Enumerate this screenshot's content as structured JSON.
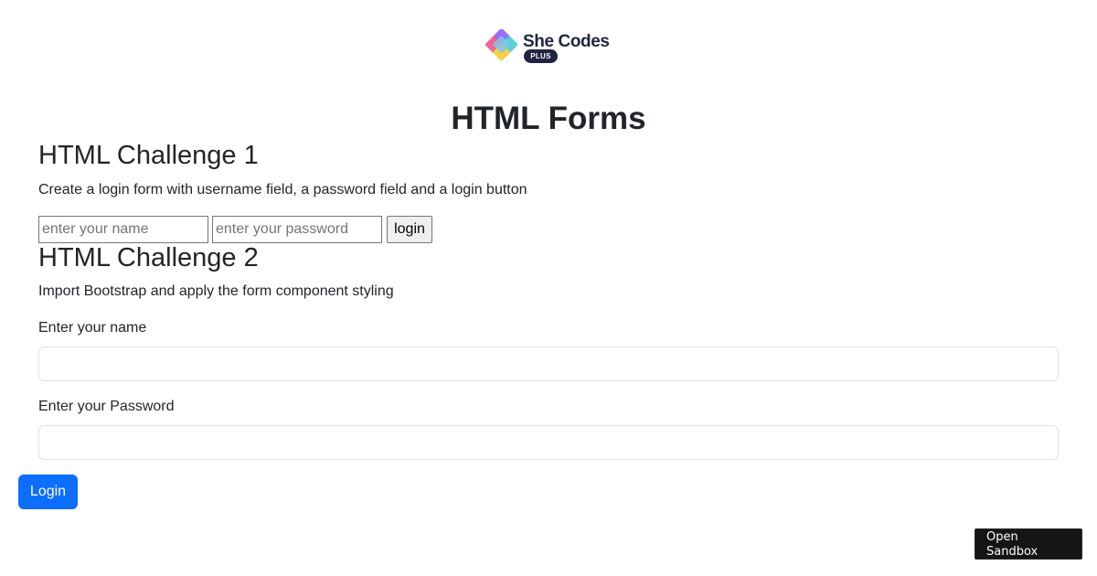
{
  "logo": {
    "brand_text": "She Codes",
    "badge_text": "PLUS",
    "colors": {
      "pink": "#f25c8e",
      "purple": "#9b6ff5",
      "teal": "#55cbd6",
      "yellow": "#f9cf4a",
      "navy": "#1f2540"
    }
  },
  "page": {
    "title": "HTML Forms"
  },
  "challenge1": {
    "heading": "HTML Challenge 1",
    "description": "Create a login form with username field, a password field and a login button",
    "name_placeholder": "enter your name",
    "password_placeholder": "enter your password",
    "button_label": "login"
  },
  "challenge2": {
    "heading": "HTML Challenge 2",
    "description": "Import Bootstrap and apply the form component styling",
    "name_label": "Enter your name",
    "name_value": "",
    "password_label": "Enter your Password",
    "password_value": "",
    "button_label": "Login",
    "button_color": "#0d6efd"
  },
  "sandbox": {
    "label": "Open Sandbox"
  }
}
